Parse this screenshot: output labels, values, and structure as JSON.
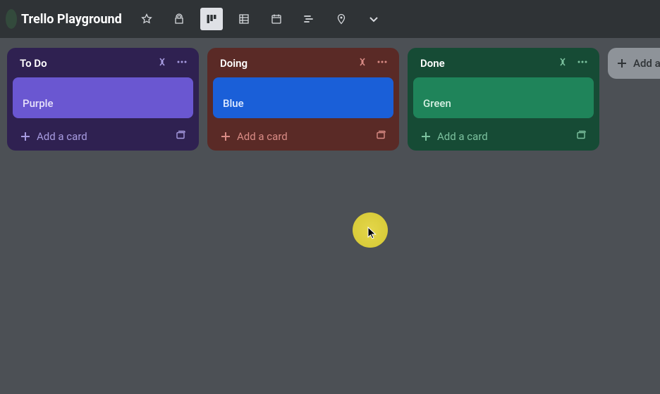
{
  "header": {
    "board_title": "Trello Playground"
  },
  "lists": [
    {
      "title": "To Do",
      "card_label": "Purple",
      "add_card_label": "Add a card"
    },
    {
      "title": "Doing",
      "card_label": "Blue",
      "add_card_label": "Add a card"
    },
    {
      "title": "Done",
      "card_label": "Green",
      "add_card_label": "Add a card"
    }
  ],
  "add_list": {
    "label": "Add a"
  },
  "colors": {
    "list_todo_bg": "#2f2151",
    "card_purple": "#6a57d1",
    "list_doing_bg": "#5a2a26",
    "card_blue": "#1a5fd8",
    "list_done_bg": "#164b35",
    "card_green": "#1f845a",
    "board_bg": "#4c5055"
  }
}
